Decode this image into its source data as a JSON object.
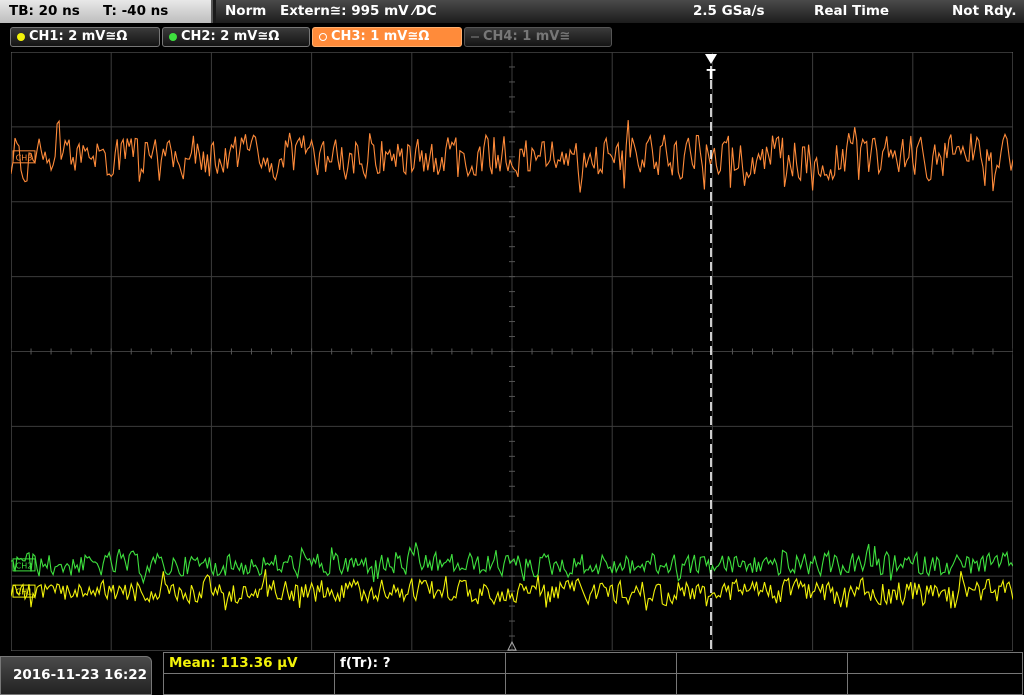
{
  "header": {
    "timebase_label": "TB: 20 ns",
    "trigger_offset_label": "T: -40 ns",
    "trigger_mode": "Norm",
    "trigger_source": "Extern≅: 995 mV ⁄DC",
    "sample_rate": "2.5 GSa/s",
    "acquisition_mode": "Real Time",
    "status": "Not Rdy."
  },
  "channels": [
    {
      "label": "CH1: 2 mV≅Ω",
      "color": "#f2f20a",
      "active": true
    },
    {
      "label": "CH2: 2 mV≅Ω",
      "color": "#3ee03e",
      "active": true
    },
    {
      "label": "CH3: 1 mV≅Ω",
      "color": "#ff8b3a",
      "active": true,
      "selected": true
    },
    {
      "label": "CH4: 1 mV≅",
      "color": "#777777",
      "active": false
    }
  ],
  "display": {
    "trigger_marker": "T",
    "channel_markers": [
      "CH3",
      "CH2",
      "CH1"
    ],
    "colors": {
      "grid": "#3c3c3c",
      "background": "#000000",
      "trigger_line": "#ffffff"
    }
  },
  "chart_data": {
    "type": "line",
    "grid": true,
    "x_divisions": 10,
    "y_divisions": 8,
    "series": [
      {
        "channel": "CH3",
        "color": "#ff8b3a",
        "offset_div": -2.6,
        "amplitude_div": 0.6
      },
      {
        "channel": "CH2",
        "color": "#3ee03e",
        "offset_div": 2.85,
        "amplitude_div": 0.33
      },
      {
        "channel": "CH1",
        "color": "#f2f20a",
        "offset_div": 3.2,
        "amplitude_div": 0.33
      }
    ]
  },
  "measurements": {
    "mean": "Mean: 113.36 µV",
    "ftr": "f(Tr): ?"
  },
  "footer": {
    "datetime": "2016-11-23 16:22"
  }
}
